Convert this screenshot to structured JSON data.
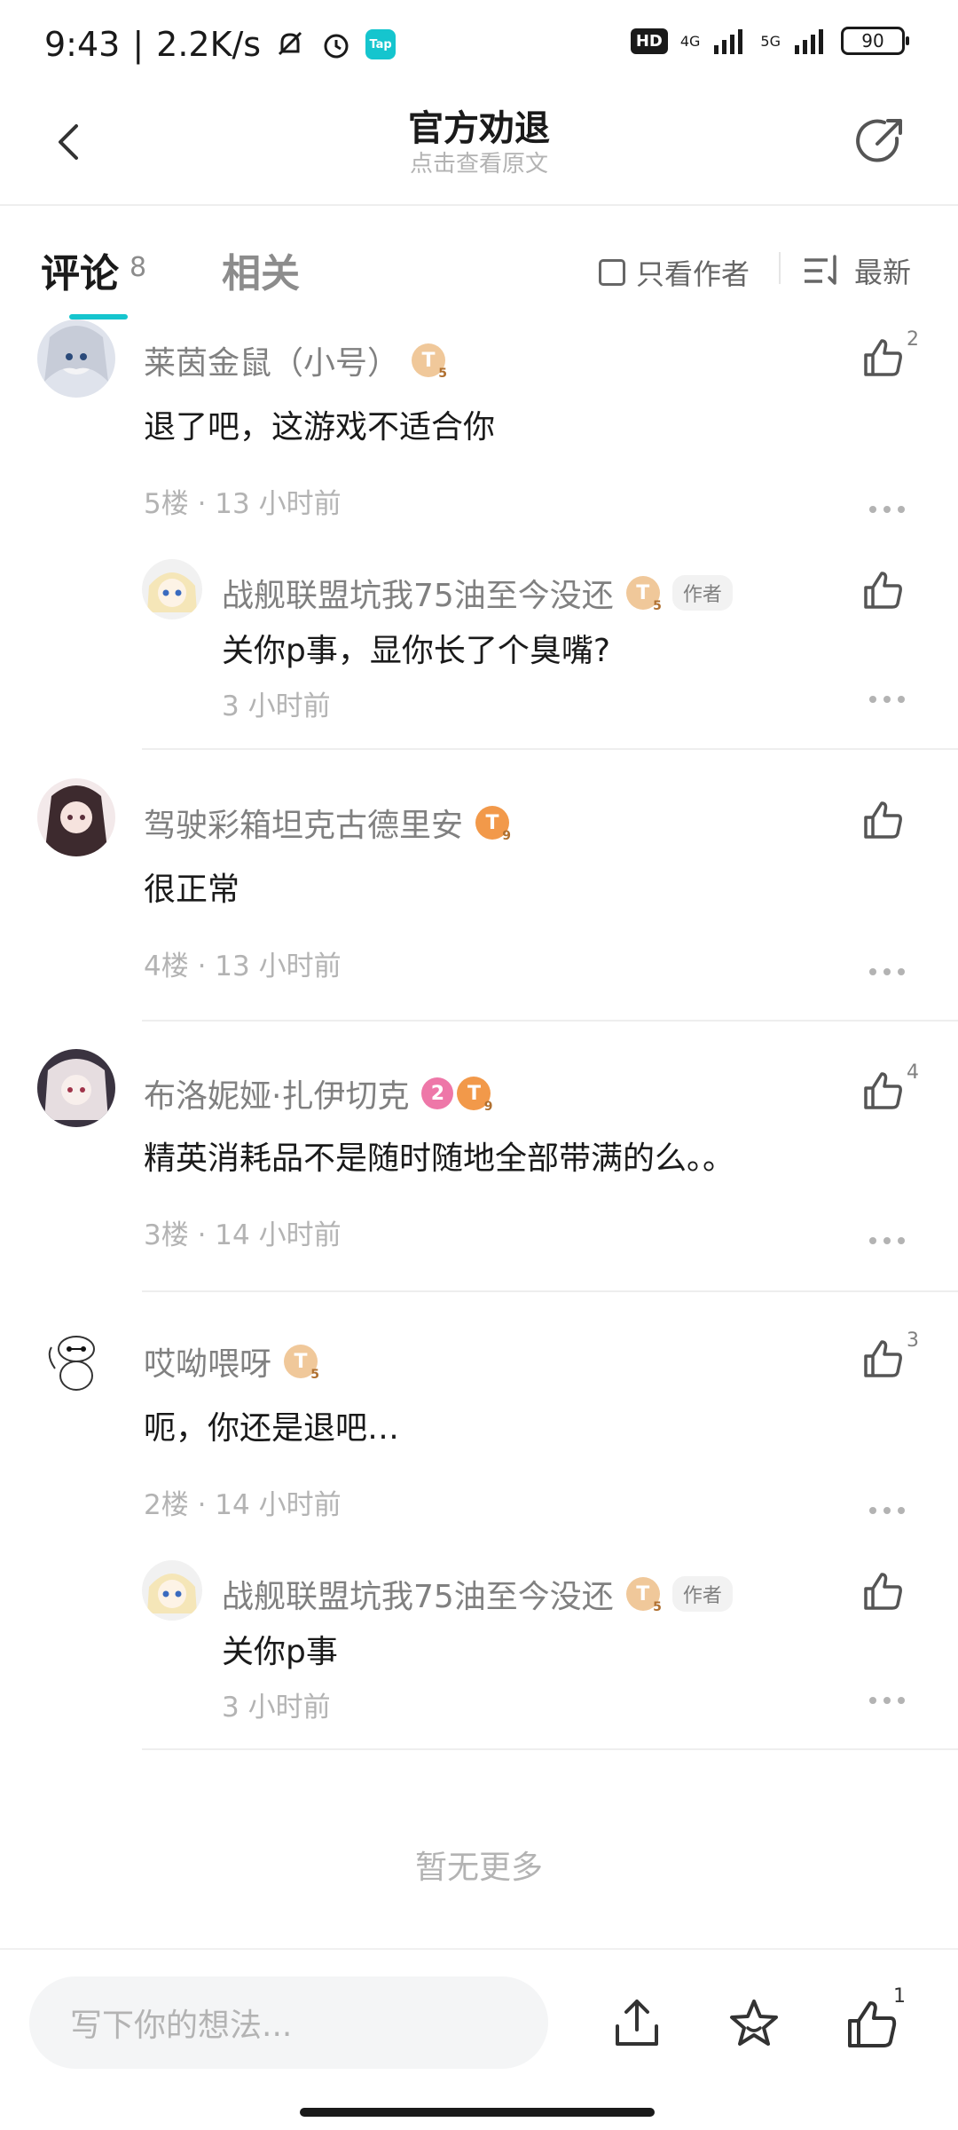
{
  "status_bar": {
    "time": "9:43",
    "speed": "2.2K/s",
    "tap_badge": "Tap",
    "hd": "HD",
    "net1": "4G",
    "net2": "5G",
    "battery": "90"
  },
  "header": {
    "title": "官方劝退",
    "subtitle": "点击查看原文"
  },
  "tabs": {
    "comments_label": "评论",
    "comments_count": "8",
    "related_label": "相关",
    "only_author_label": "只看作者",
    "sort_label": "最新"
  },
  "comments": [
    {
      "username": "莱茵金鼠（小号）",
      "level": "T",
      "level_sub": "5",
      "text": "退了吧，这游戏不适合你",
      "meta": "5楼 · 13 小时前",
      "likes": "2",
      "reply": {
        "username": "战舰联盟坑我75油至今没还",
        "level": "T",
        "level_sub": "5",
        "tag": "作者",
        "text": "关你p事，显你长了个臭嘴?",
        "meta": "3 小时前"
      }
    },
    {
      "username": "驾驶彩箱坦克古德里安",
      "level": "T",
      "level_sub": "9",
      "text": "很正常",
      "meta": "4楼 · 13 小时前",
      "likes": ""
    },
    {
      "username": "布洛妮娅·扎伊切克",
      "pink_badge": "2",
      "level": "T",
      "level_sub": "9",
      "text": "精英消耗品不是随时随地全部带满的么。。",
      "meta": "3楼 · 14 小时前",
      "likes": "4"
    },
    {
      "username": "哎呦喂呀",
      "level": "T",
      "level_sub": "5",
      "text": "呃，你还是退吧…",
      "meta": "2楼 · 14 小时前",
      "likes": "3",
      "reply": {
        "username": "战舰联盟坑我75油至今没还",
        "level": "T",
        "level_sub": "5",
        "tag": "作者",
        "text": "关你p事",
        "meta": "3 小时前"
      }
    }
  ],
  "footer_note": "暂无更多",
  "bottom_bar": {
    "input_placeholder": "写下你的想法...",
    "like_count": "1"
  },
  "colors": {
    "accent": "#15c5ce",
    "muted_text": "#b3b3b3",
    "name_text": "#808080"
  }
}
